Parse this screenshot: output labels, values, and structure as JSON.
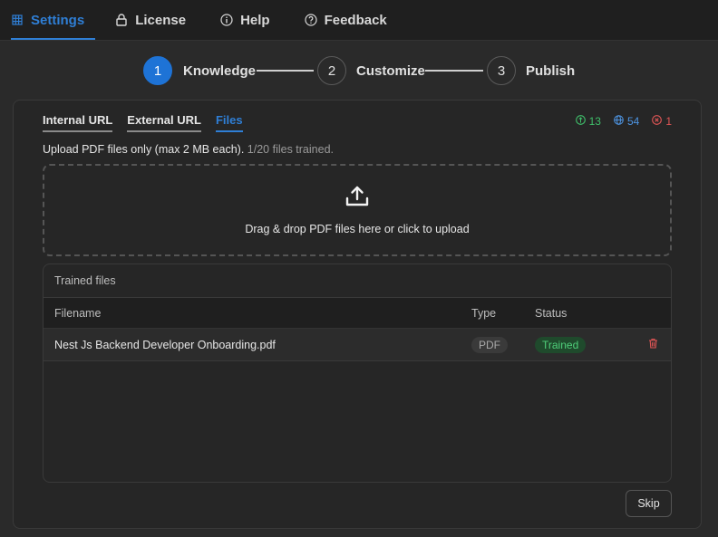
{
  "nav": {
    "items": [
      {
        "label": "Settings",
        "icon": "grid-icon",
        "active": true
      },
      {
        "label": "License",
        "icon": "lock-icon",
        "active": false
      },
      {
        "label": "Help",
        "icon": "info-icon",
        "active": false
      },
      {
        "label": "Feedback",
        "icon": "question-icon",
        "active": false
      }
    ]
  },
  "stepper": {
    "steps": [
      {
        "number": "1",
        "label": "Knowledge",
        "active": true
      },
      {
        "number": "2",
        "label": "Customize",
        "active": false
      },
      {
        "number": "3",
        "label": "Publish",
        "active": false
      }
    ]
  },
  "tabs": [
    {
      "label": "Internal URL",
      "active": false
    },
    {
      "label": "External URL",
      "active": false
    },
    {
      "label": "Files",
      "active": true
    }
  ],
  "counts": {
    "trained": "13",
    "urls": "54",
    "errors": "1"
  },
  "upload": {
    "note": "Upload PDF files only (max 2 MB each).",
    "progress": "1/20 files trained.",
    "dropzone_text": "Drag & drop PDF files here or click to upload"
  },
  "files": {
    "title": "Trained files",
    "columns": {
      "filename": "Filename",
      "type": "Type",
      "status": "Status"
    },
    "rows": [
      {
        "filename": "Nest Js Backend Developer Onboarding.pdf",
        "type": "PDF",
        "status": "Trained"
      }
    ]
  },
  "skip_label": "Skip",
  "colors": {
    "accent": "#1e73d6",
    "success": "#3fbf6a",
    "danger": "#e05555"
  }
}
